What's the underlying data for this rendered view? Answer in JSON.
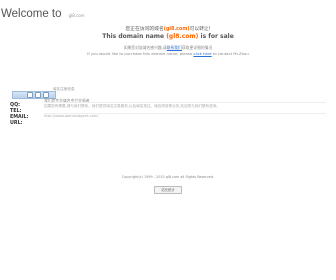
{
  "header": {
    "title": "Welcome to",
    "subtitle": "gl8.com"
  },
  "notice": {
    "cn_prefix": "您正在访问的域名",
    "cn_domain": "(gl8.com)",
    "cn_suffix": "可以转让!",
    "en_prefix": "This domain name",
    "en_domain": "(gl8.com)",
    "en_suffix": "is for sale"
  },
  "contact": {
    "cn_prefix": "如果您对该域名感兴趣,请",
    "cn_link": "联系我们",
    "cn_suffix": "获取更详细的情况",
    "en_prefix": "If you would like to purchase this domain name, please",
    "en_link": "click here",
    "en_suffix": "to contact Mr.Zhou"
  },
  "panel": {
    "title": "域名注册信息",
    "line1": "我们是专业域名中介交易者",
    "line2": "如果您有需要,请与我们联系。我们提供域名交易服务,以及域名抢注、域名停放等业务,欢迎您与我们联系咨询。",
    "line3": "http://www.domainagent.com/",
    "labels": {
      "qq": "QQ:",
      "tel": "TEL:",
      "email": "EMAIL:",
      "url": "URL:"
    },
    "values": {
      "qq": "",
      "tel": "",
      "email": "",
      "url": ""
    }
  },
  "footer": {
    "copyright": "Copyright(c) 1999 - 2015 gl8.com all Rights Reserved.",
    "button_label": "站长统计"
  }
}
